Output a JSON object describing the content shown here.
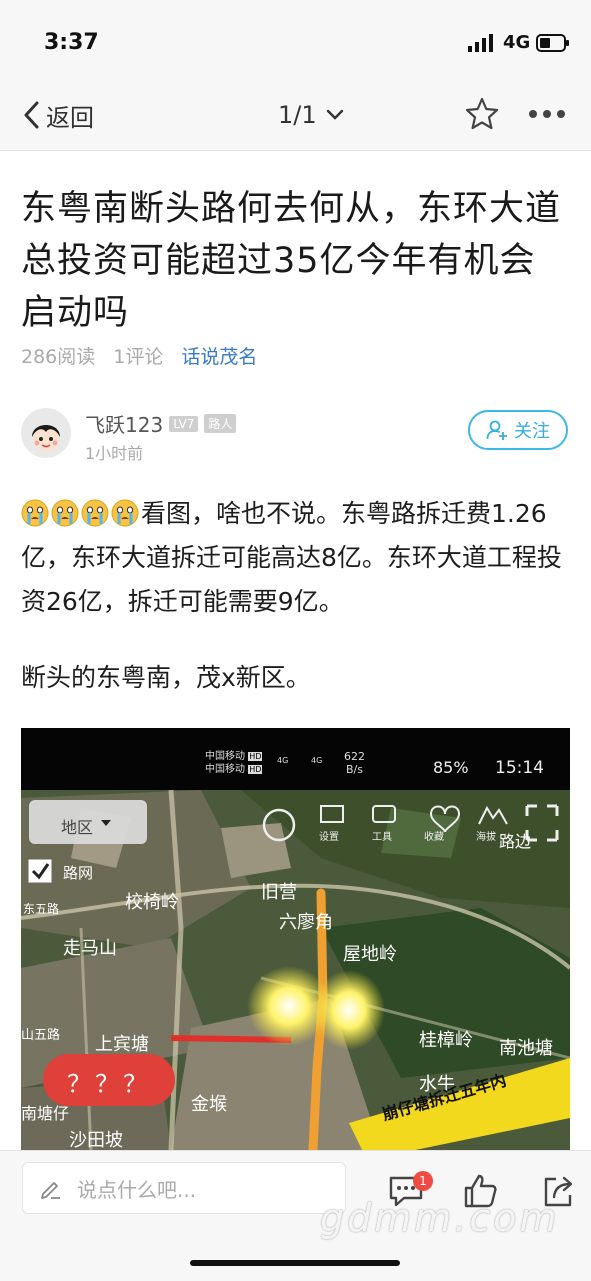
{
  "status": {
    "time": "3:37",
    "network": "4G"
  },
  "nav": {
    "back_label": "返回",
    "pager": "1/1"
  },
  "article": {
    "title": "东粤南断头路何去何从，东环大道总投资可能超过35亿今年有机会启动吗",
    "views": "286阅读",
    "comments": "1评论",
    "forum": "话说茂名",
    "author": {
      "name": "飞跃123",
      "level": "LV7",
      "role": "路人",
      "time": "1小时前"
    },
    "follow_label": "关注",
    "paragraph1": "看图，啥也不说。东粤路拆迁费1.26亿，东环大道拆迁可能高达8亿。东环大道工程投资26亿，拆迁可能需要9亿。",
    "paragraph2": "断头的东粤南，茂x新区。"
  },
  "map_screenshot": {
    "status": {
      "carrier1": "中国移动",
      "carrier2": "中国移动",
      "hd": "HD",
      "sig": "4G",
      "speed": "622",
      "speed_unit": "B/s",
      "battery": "85%",
      "time": "15:14"
    },
    "region_button": "地区",
    "road_net_label": "路网",
    "tools": [
      "设置",
      "工具",
      "收藏",
      "海拔"
    ],
    "places": [
      "路边",
      "东五路",
      "校椅岭",
      "旧营",
      "六廖角",
      "走马山",
      "屋地岭",
      "山五路",
      "上宾塘",
      "桂樟岭",
      "南池塘",
      "水牛",
      "金堠",
      "南塘仔",
      "沙田坡"
    ],
    "red_label": "？？？",
    "banner": "崩仔塘拆迁五年内"
  },
  "bottom": {
    "comment_placeholder": "说点什么吧...",
    "comment_count": "1"
  },
  "watermark": "gdmm.com"
}
